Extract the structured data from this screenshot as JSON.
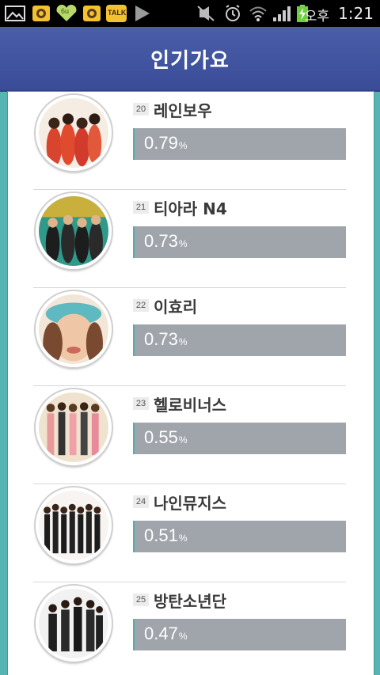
{
  "status_bar": {
    "icons": [
      "gallery-icon",
      "kakao-story-icon",
      "heart-icon",
      "kakao-story-icon",
      "kakaotalk-icon",
      "play-icon",
      "mute-icon",
      "alarm-icon",
      "wifi-icon",
      "signal-icon",
      "battery-charging-icon"
    ],
    "kakaotalk_label": "TALK",
    "heart_label": "6u",
    "ampm": "오후",
    "time": "1:21"
  },
  "header": {
    "title": "인기가요"
  },
  "colors": {
    "header": "#4a5ea8",
    "accent": "#56b4b2",
    "bar": "#a0a4ab"
  },
  "chart": {
    "items": [
      {
        "rank": "20",
        "name": "레인보우",
        "value": "0.79",
        "unit": "%"
      },
      {
        "rank": "21",
        "name": "티아라 N4",
        "value": "0.73",
        "unit": "%"
      },
      {
        "rank": "22",
        "name": "이효리",
        "value": "0.73",
        "unit": "%"
      },
      {
        "rank": "23",
        "name": "헬로비너스",
        "value": "0.55",
        "unit": "%"
      },
      {
        "rank": "24",
        "name": "나인뮤지스",
        "value": "0.51",
        "unit": "%"
      },
      {
        "rank": "25",
        "name": "방탄소년단",
        "value": "0.47",
        "unit": "%"
      }
    ]
  }
}
